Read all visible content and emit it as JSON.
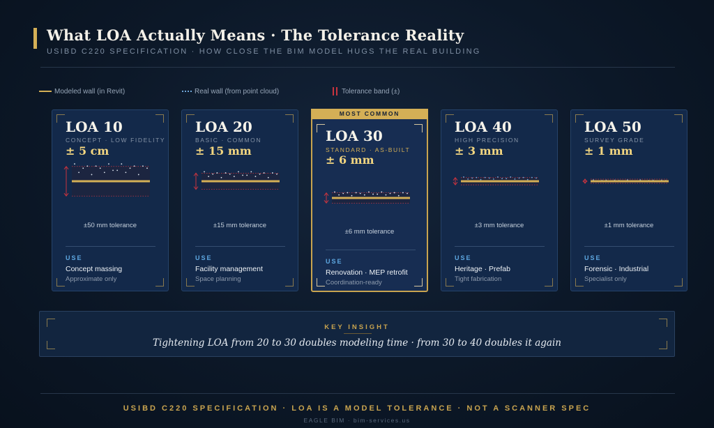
{
  "header": {
    "title": "What LOA Actually Means · The Tolerance Reality",
    "subtitle": "USIBD C220 SPECIFICATION · HOW CLOSE THE BIM MODEL HUGS THE REAL BUILDING"
  },
  "legend": {
    "modeled": "Modeled wall (in Revit)",
    "real": "Real wall (from point cloud)",
    "tolerance": "Tolerance band (±)"
  },
  "colors": {
    "accent_gold": "#d4af56",
    "tolerance_red": "#c8343f",
    "real_wall_blue": "#6fa7d9",
    "use_label_blue": "#5ea8e2"
  },
  "cards": [
    {
      "name": "LOA 10",
      "class": "CONCEPT · LOW FIDELITY",
      "tolerance": "± 5 cm",
      "tolerance_mm": 50,
      "caption": "±50 mm tolerance",
      "use_label": "USE",
      "use": "Concept massing",
      "use_sub": "Approximate only"
    },
    {
      "name": "LOA 20",
      "class": "BASIC · COMMON",
      "tolerance": "± 15 mm",
      "tolerance_mm": 15,
      "caption": "±15 mm tolerance",
      "use_label": "USE",
      "use": "Facility management",
      "use_sub": "Space planning"
    },
    {
      "name": "LOA 30",
      "class": "STANDARD · AS-BUILT",
      "tolerance": "± 6 mm",
      "tolerance_mm": 6,
      "caption": "±6 mm tolerance",
      "badge": "MOST COMMON",
      "use_label": "USE",
      "use": "Renovation · MEP retrofit",
      "use_sub": "Coordination-ready"
    },
    {
      "name": "LOA 40",
      "class": "HIGH PRECISION",
      "tolerance": "± 3 mm",
      "tolerance_mm": 3,
      "caption": "±3 mm tolerance",
      "use_label": "USE",
      "use": "Heritage · Prefab",
      "use_sub": "Tight fabrication"
    },
    {
      "name": "LOA 50",
      "class": "SURVEY GRADE",
      "tolerance": "± 1 mm",
      "tolerance_mm": 1,
      "caption": "±1 mm tolerance",
      "use_label": "USE",
      "use": "Forensic · Industrial",
      "use_sub": "Specialist only"
    }
  ],
  "insight": {
    "label": "KEY INSIGHT",
    "text": "Tightening LOA from 20 to 30 doubles modeling time · from 30 to 40 doubles it again"
  },
  "footer": {
    "main": "USIBD C220 SPECIFICATION · LOA IS A MODEL TOLERANCE · NOT A SCANNER SPEC",
    "sub": "EAGLE BIM · bim-services.us"
  }
}
